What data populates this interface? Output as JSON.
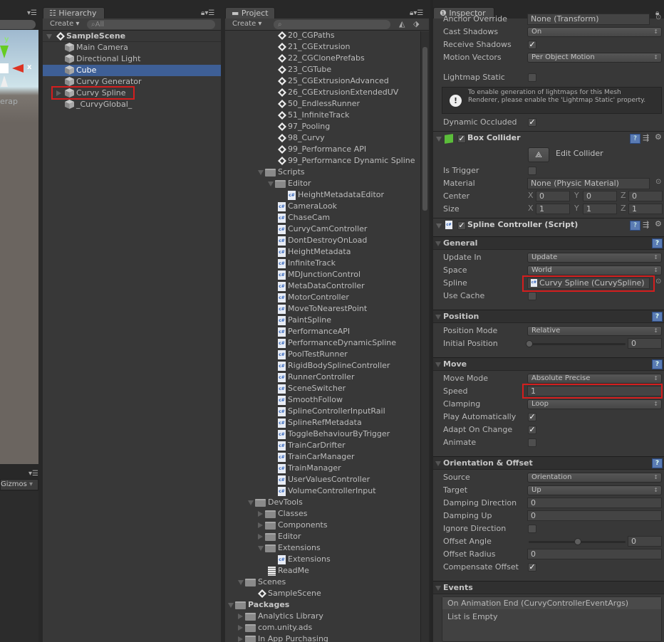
{
  "scene_view": {
    "axis_y": "y",
    "axis_x": "x",
    "overlay_text": "erap",
    "gizmos_label": "Gizmos"
  },
  "hierarchy": {
    "tab": "Hierarchy",
    "create": "Create",
    "search_placeholder": "All",
    "scene": "SampleScene",
    "items": [
      {
        "label": "Main Camera",
        "selected": false,
        "expandable": false
      },
      {
        "label": "Directional Light",
        "selected": false,
        "expandable": false
      },
      {
        "label": "Cube",
        "selected": true,
        "expandable": false
      },
      {
        "label": "Curvy Generator",
        "selected": false,
        "expandable": false
      },
      {
        "label": "Curvy Spline",
        "selected": false,
        "expandable": true,
        "highlighted": true
      },
      {
        "label": "_CurvyGlobal_",
        "selected": false,
        "expandable": false
      }
    ]
  },
  "project": {
    "tab": "Project",
    "create": "Create",
    "search_placeholder": "",
    "items": [
      {
        "label": "20_CGPaths",
        "kind": "scene",
        "level": 4
      },
      {
        "label": "21_CGExtrusion",
        "kind": "scene",
        "level": 4
      },
      {
        "label": "22_CGClonePrefabs",
        "kind": "scene",
        "level": 4
      },
      {
        "label": "23_CGTube",
        "kind": "scene",
        "level": 4
      },
      {
        "label": "25_CGExtrusionAdvanced",
        "kind": "scene",
        "level": 4
      },
      {
        "label": "26_CGExtrusionExtendedUV",
        "kind": "scene",
        "level": 4
      },
      {
        "label": "50_EndlessRunner",
        "kind": "scene",
        "level": 4
      },
      {
        "label": "51_InfiniteTrack",
        "kind": "scene",
        "level": 4
      },
      {
        "label": "97_Pooling",
        "kind": "scene",
        "level": 4
      },
      {
        "label": "98_Curvy",
        "kind": "scene",
        "level": 4
      },
      {
        "label": "99_Performance API",
        "kind": "scene",
        "level": 4
      },
      {
        "label": "99_Performance Dynamic Spline",
        "kind": "scene",
        "level": 4
      },
      {
        "label": "Scripts",
        "kind": "folder",
        "level": 3,
        "expand": "open"
      },
      {
        "label": "Editor",
        "kind": "folder",
        "level": 4,
        "expand": "open"
      },
      {
        "label": "HeightMetadataEditor",
        "kind": "script",
        "level": 5
      },
      {
        "label": "CameraLook",
        "kind": "script",
        "level": 4
      },
      {
        "label": "ChaseCam",
        "kind": "script",
        "level": 4
      },
      {
        "label": "CurvyCamController",
        "kind": "script",
        "level": 4
      },
      {
        "label": "DontDestroyOnLoad",
        "kind": "script",
        "level": 4
      },
      {
        "label": "HeightMetadata",
        "kind": "script",
        "level": 4
      },
      {
        "label": "InfiniteTrack",
        "kind": "script",
        "level": 4
      },
      {
        "label": "MDJunctionControl",
        "kind": "script",
        "level": 4
      },
      {
        "label": "MetaDataController",
        "kind": "script",
        "level": 4
      },
      {
        "label": "MotorController",
        "kind": "script",
        "level": 4
      },
      {
        "label": "MoveToNearestPoint",
        "kind": "script",
        "level": 4
      },
      {
        "label": "PaintSpline",
        "kind": "script",
        "level": 4
      },
      {
        "label": "PerformanceAPI",
        "kind": "script",
        "level": 4
      },
      {
        "label": "PerformanceDynamicSpline",
        "kind": "script",
        "level": 4
      },
      {
        "label": "PoolTestRunner",
        "kind": "script",
        "level": 4
      },
      {
        "label": "RigidBodySplineController",
        "kind": "script",
        "level": 4
      },
      {
        "label": "RunnerController",
        "kind": "script",
        "level": 4
      },
      {
        "label": "SceneSwitcher",
        "kind": "script",
        "level": 4
      },
      {
        "label": "SmoothFollow",
        "kind": "script",
        "level": 4
      },
      {
        "label": "SplineControllerInputRail",
        "kind": "script",
        "level": 4
      },
      {
        "label": "SplineRefMetadata",
        "kind": "script",
        "level": 4
      },
      {
        "label": "ToggleBehaviourByTrigger",
        "kind": "script",
        "level": 4
      },
      {
        "label": "TrainCarDrifter",
        "kind": "script",
        "level": 4
      },
      {
        "label": "TrainCarManager",
        "kind": "script",
        "level": 4
      },
      {
        "label": "TrainManager",
        "kind": "script",
        "level": 4
      },
      {
        "label": "UserValuesController",
        "kind": "script",
        "level": 4
      },
      {
        "label": "VolumeControllerInput",
        "kind": "script",
        "level": 4
      },
      {
        "label": "DevTools",
        "kind": "folder",
        "level": 2,
        "expand": "open"
      },
      {
        "label": "Classes",
        "kind": "folder",
        "level": 3,
        "expand": "closed"
      },
      {
        "label": "Components",
        "kind": "folder",
        "level": 3,
        "expand": "closed"
      },
      {
        "label": "Editor",
        "kind": "folder",
        "level": 3,
        "expand": "closed"
      },
      {
        "label": "Extensions",
        "kind": "folder",
        "level": 3,
        "expand": "open"
      },
      {
        "label": "Extensions",
        "kind": "script",
        "level": 4
      },
      {
        "label": "ReadMe",
        "kind": "text",
        "level": 3
      },
      {
        "label": "Scenes",
        "kind": "folder",
        "level": 1,
        "expand": "open"
      },
      {
        "label": "SampleScene",
        "kind": "scene",
        "level": 2
      },
      {
        "label": "Packages",
        "kind": "folder",
        "level": 0,
        "expand": "open",
        "bold": true
      },
      {
        "label": "Analytics Library",
        "kind": "folder",
        "level": 1,
        "expand": "closed"
      },
      {
        "label": "com.unity.ads",
        "kind": "folder",
        "level": 1,
        "expand": "closed"
      },
      {
        "label": "In App Purchasing",
        "kind": "folder",
        "level": 1,
        "expand": "closed"
      }
    ]
  },
  "inspector": {
    "tab": "Inspector",
    "items": [
      {
        "kind": "field",
        "type": "object",
        "label": "Anchor Override",
        "value": "None (Transform)"
      },
      {
        "kind": "field",
        "type": "dropdown",
        "label": "Cast Shadows",
        "value": "On"
      },
      {
        "kind": "field",
        "type": "checkbox",
        "label": "Receive Shadows",
        "checked": true
      },
      {
        "kind": "field",
        "type": "dropdown",
        "label": "Motion Vectors",
        "value": "Per Object Motion"
      },
      {
        "kind": "field",
        "type": "checkbox",
        "label": "Lightmap Static",
        "checked": false
      },
      {
        "kind": "helpbox",
        "text": "To enable generation of lightmaps for this Mesh Renderer, please enable the 'Lightmap Static' property."
      },
      {
        "kind": "field",
        "type": "checkbox",
        "label": "Dynamic Occluded",
        "checked": true
      },
      {
        "kind": "component",
        "label": "Box Collider",
        "icon": "box-collider-icon",
        "enabled": true
      },
      {
        "kind": "button",
        "label": "Edit Collider"
      },
      {
        "kind": "field",
        "type": "checkbox",
        "label": "Is Trigger",
        "checked": false
      },
      {
        "kind": "field",
        "type": "object",
        "label": "Material",
        "value": "None (Physic Material)"
      },
      {
        "kind": "field",
        "type": "vector3",
        "label": "Center",
        "x": "0",
        "y": "0",
        "z": "0"
      },
      {
        "kind": "field",
        "type": "vector3",
        "label": "Size",
        "x": "1",
        "y": "1",
        "z": "1"
      },
      {
        "kind": "component",
        "label": "Spline Controller (Script)",
        "icon": "script-icon",
        "enabled": true
      },
      {
        "kind": "section",
        "label": "General"
      },
      {
        "kind": "field",
        "type": "dropdown",
        "label": "Update In",
        "value": "Update"
      },
      {
        "kind": "field",
        "type": "dropdown",
        "label": "Space",
        "value": "World"
      },
      {
        "kind": "field",
        "type": "object",
        "label": "Spline",
        "value": "Curvy Spline (CurvySpline)",
        "highlighted": true,
        "icon": true
      },
      {
        "kind": "field",
        "type": "checkbox",
        "label": "Use Cache",
        "checked": false
      },
      {
        "kind": "section",
        "label": "Position"
      },
      {
        "kind": "field",
        "type": "dropdown",
        "label": "Position Mode",
        "value": "Relative"
      },
      {
        "kind": "field",
        "type": "slider",
        "label": "Initial Position",
        "value": "0",
        "level": 0
      },
      {
        "kind": "section",
        "label": "Move"
      },
      {
        "kind": "field",
        "type": "dropdown",
        "label": "Move Mode",
        "value": "Absolute Precise"
      },
      {
        "kind": "field",
        "type": "text",
        "label": "Speed",
        "value": "1",
        "highlighted": true
      },
      {
        "kind": "field",
        "type": "dropdown",
        "label": "Clamping",
        "value": "Loop"
      },
      {
        "kind": "field",
        "type": "checkbox",
        "label": "Play Automatically",
        "checked": true
      },
      {
        "kind": "field",
        "type": "checkbox",
        "label": "Adapt On Change",
        "checked": true
      },
      {
        "kind": "field",
        "type": "checkbox",
        "label": "Animate",
        "checked": false
      },
      {
        "kind": "section",
        "label": "Orientation & Offset"
      },
      {
        "kind": "field",
        "type": "dropdown",
        "label": "Source",
        "value": "Orientation"
      },
      {
        "kind": "field",
        "type": "dropdown",
        "label": "Target",
        "value": "Up"
      },
      {
        "kind": "field",
        "type": "text",
        "label": "Damping Direction",
        "value": "0"
      },
      {
        "kind": "field",
        "type": "text",
        "label": "Damping Up",
        "value": "0"
      },
      {
        "kind": "field",
        "type": "checkbox",
        "label": "Ignore Direction",
        "checked": false
      },
      {
        "kind": "field",
        "type": "slider",
        "label": "Offset Angle",
        "value": "0",
        "level": 0.5
      },
      {
        "kind": "field",
        "type": "text",
        "label": "Offset Radius",
        "value": "0"
      },
      {
        "kind": "field",
        "type": "checkbox",
        "label": "Compensate Offset",
        "checked": true
      },
      {
        "kind": "section",
        "label": "Events"
      },
      {
        "kind": "events",
        "title": "On Animation End (CurvyControllerEventArgs)",
        "empty": "List is Empty"
      }
    ]
  },
  "colors": {
    "selection": "#3e5f96",
    "highlight": "#d41e1e",
    "panel": "#383838"
  }
}
